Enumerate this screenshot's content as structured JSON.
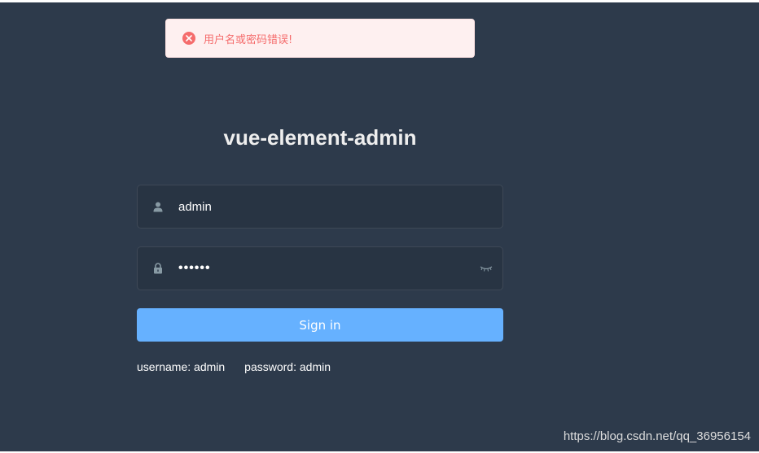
{
  "toast": {
    "message": "用户名或密码错误!",
    "icon": "error-circle-icon",
    "color": "#f56c6c"
  },
  "login": {
    "title": "vue-element-admin",
    "username_value": "admin",
    "password_masked": "••••••",
    "signin_label": "Sign in",
    "tip_username": "username: admin",
    "tip_password": "password: admin"
  },
  "colors": {
    "background": "#2d3a4b",
    "button": "#66b1ff"
  },
  "watermark": "https://blog.csdn.net/qq_36956154"
}
